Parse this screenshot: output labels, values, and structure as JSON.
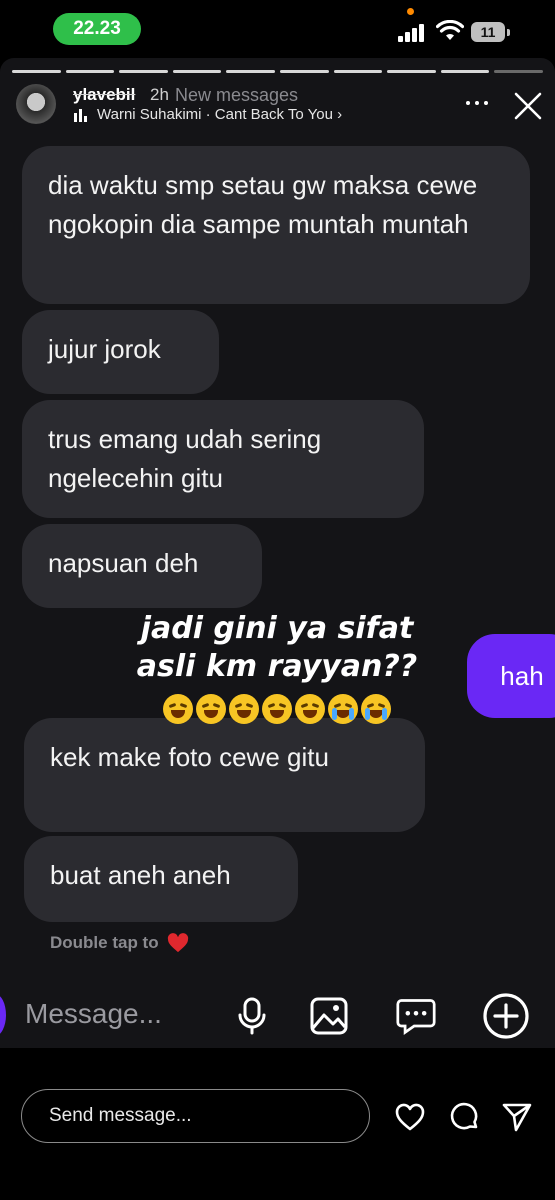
{
  "status_bar": {
    "time": "22.23",
    "battery": "11"
  },
  "story": {
    "username": "ylavebil",
    "time_ago": "2h",
    "new_messages_label": "New messages",
    "music": "Warni Suhakimi · Cant Back To You ›",
    "progress": {
      "total_segments": 10,
      "active_segments": 9
    }
  },
  "messages": [
    {
      "text": "dia waktu smp setau gw maksa cewe ngokopin dia sampe muntah muntah"
    },
    {
      "text": "jujur jorok"
    },
    {
      "text": "trus emang udah sering ngelecehin gitu"
    },
    {
      "text": "napsuan deh"
    },
    {
      "text": "hah"
    },
    {
      "text": "kek make foto cewe gitu"
    },
    {
      "text": "buat aneh aneh"
    }
  ],
  "overlay": {
    "line1": "jadi gini ya sifat",
    "line2": "asli km rayyan??",
    "emojis": [
      "rofl-emoji",
      "rofl-emoji",
      "rofl-emoji",
      "rofl-emoji",
      "rofl-emoji",
      "crying-emoji",
      "crying-emoji"
    ]
  },
  "double_tap_label": "Double tap to",
  "composer": {
    "placeholder": "Message..."
  },
  "reply_bar": {
    "placeholder": "Send message..."
  },
  "colors": {
    "outgoing": "#6a28f5",
    "incoming": "#2b2b30",
    "pill": "#2fbf4a"
  }
}
